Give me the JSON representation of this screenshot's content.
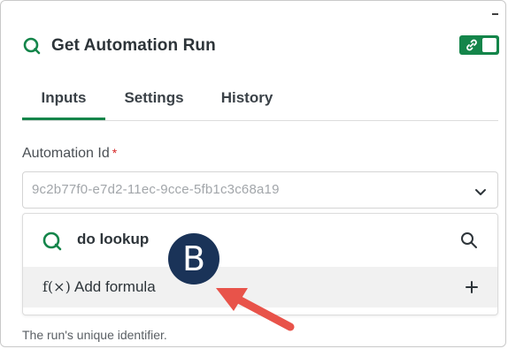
{
  "panel": {
    "title": "Get Automation Run",
    "toggle_on": true,
    "colors": {
      "accent": "#14854a",
      "marker": "#1a3358",
      "arrow": "#e8534a",
      "required": "#d62828"
    }
  },
  "tabs": [
    {
      "label": "Inputs",
      "active": true
    },
    {
      "label": "Settings",
      "active": false
    },
    {
      "label": "History",
      "active": false
    }
  ],
  "field": {
    "label": "Automation Id",
    "required_mark": "*",
    "placeholder": "9c2b77f0-e7d2-11ec-9cce-5fb1c3c68a19",
    "helper": "The run's unique identifier."
  },
  "dropdown": {
    "items": [
      {
        "label": "do lookup",
        "icon": "qlik-icon",
        "action_icon": "search-icon"
      },
      {
        "label": "Add formula",
        "icon": "fx-icon",
        "icon_text": "f(×)",
        "action_icon": "plus-icon"
      }
    ]
  },
  "annotation": {
    "marker": "B"
  }
}
